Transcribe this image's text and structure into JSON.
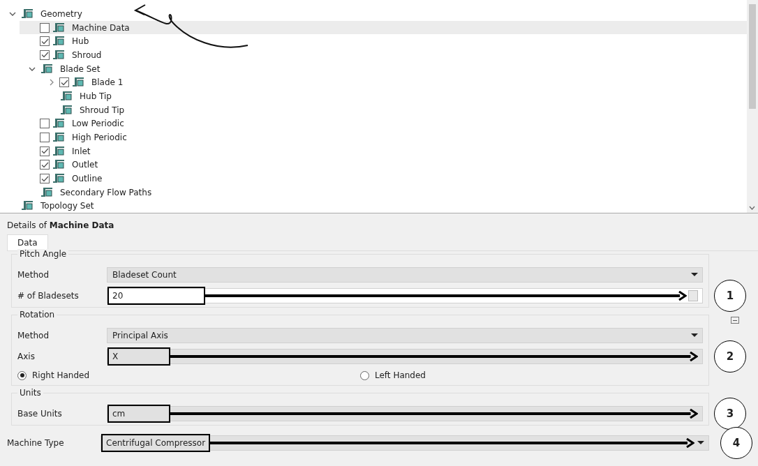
{
  "tree": [
    {
      "label": "Geometry",
      "expanded": true,
      "selected": false,
      "children": [
        {
          "label": "Machine Data",
          "checked": false,
          "selected": true
        },
        {
          "label": "Hub",
          "checked": true,
          "selected": false
        },
        {
          "label": "Shroud",
          "checked": true,
          "selected": false
        },
        {
          "label": "Blade Set",
          "expanded": true,
          "selected": false,
          "children": [
            {
              "label": "Blade 1",
              "checked": true,
              "expanded": false,
              "selected": false
            },
            {
              "label": "Hub Tip",
              "selected": false
            },
            {
              "label": "Shroud Tip",
              "selected": false
            }
          ]
        },
        {
          "label": "Low Periodic",
          "checked": false,
          "selected": false
        },
        {
          "label": "High Periodic",
          "checked": false,
          "selected": false
        },
        {
          "label": "Inlet",
          "checked": true,
          "selected": false
        },
        {
          "label": "Outlet",
          "checked": true,
          "selected": false
        },
        {
          "label": "Outline",
          "checked": true,
          "selected": false
        },
        {
          "label": "Secondary Flow Paths",
          "selected": false
        }
      ]
    },
    {
      "label": "Topology Set",
      "selected": false
    }
  ],
  "details": {
    "title": "Details of **Machine Data**",
    "tabs": [
      {
        "label": "Data",
        "selected": true
      }
    ],
    "groups": [
      {
        "title": "Pitch Angle",
        "rows": [
          {
            "kind": "dropdown",
            "label": "Method",
            "value": "Bladeset Count",
            "highlighted": false
          },
          {
            "kind": "number",
            "label": "# of Bladesets",
            "value": "20",
            "highlighted": true,
            "callout": "1"
          }
        ]
      },
      {
        "title": "Rotation",
        "expanded": true,
        "rows": [
          {
            "kind": "dropdown",
            "label": "Method",
            "value": "Principal Axis",
            "highlighted": false
          },
          {
            "kind": "text",
            "label": "Axis",
            "value": "X",
            "highlighted": true,
            "callout": "2"
          },
          {
            "kind": "radio",
            "options": [
              {
                "label": "Right Handed",
                "selected": true
              },
              {
                "label": "Left Handed",
                "selected": false
              }
            ]
          }
        ]
      },
      {
        "title": "Units",
        "rows": [
          {
            "kind": "text",
            "label": "Base Units",
            "value": "cm",
            "highlighted": true,
            "callout": "3"
          }
        ]
      }
    ],
    "machine_type": {
      "kind": "dropdown",
      "label": "Machine Type",
      "value": "Centrifugal Compressor",
      "highlighted": true,
      "callout": "4"
    }
  }
}
